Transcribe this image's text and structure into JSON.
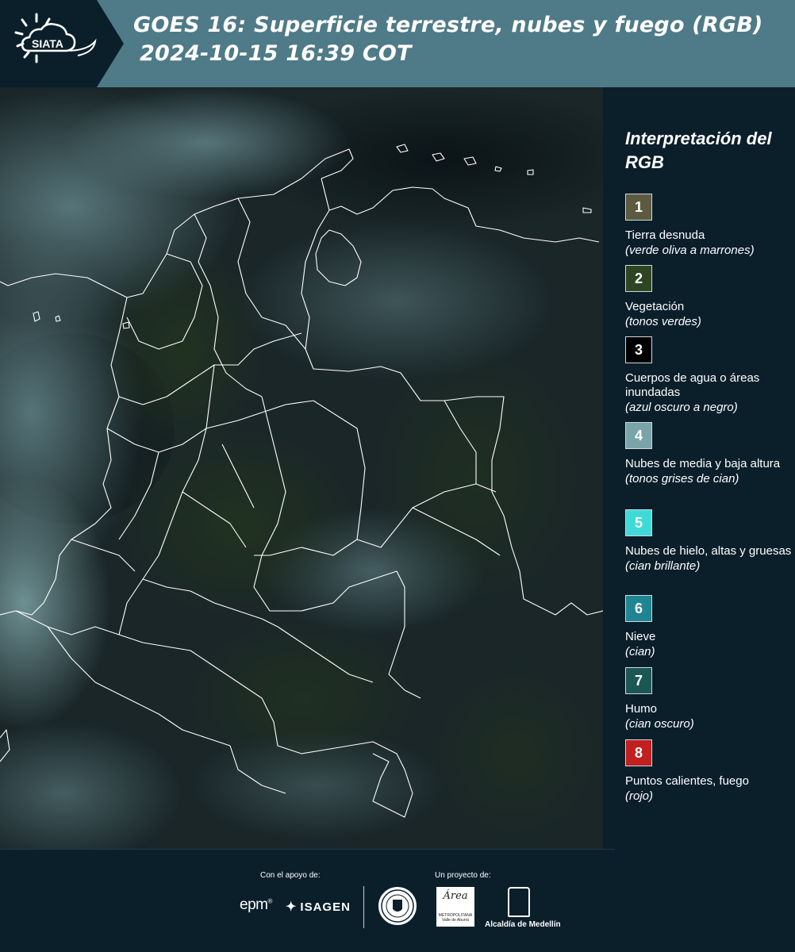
{
  "header": {
    "logo_text": "SIATA",
    "title_line1": "GOES 16: Superficie terrestre, nubes y fuego (RGB)",
    "title_line2": "2024-10-15 16:39 COT",
    "bg_color": "#4f7a87",
    "logo_panel_color": "#0b1f2b"
  },
  "legend": {
    "title": "Interpretación del RGB",
    "items": [
      {
        "num": "1",
        "label": "Tierra desnuda",
        "sub": "(verde oliva a marrones)",
        "color": "#5c5a3f"
      },
      {
        "num": "2",
        "label": "Vegetación",
        "sub": "(tonos verdes)",
        "color": "#2f4521"
      },
      {
        "num": "3",
        "label": "Cuerpos de agua o áreas inundadas",
        "sub": "(azul oscuro a negro)",
        "color": "#000000"
      },
      {
        "num": "4",
        "label": "Nubes de media y baja altura",
        "sub": "(tonos grises de cian)",
        "color": "#79a5aa"
      },
      {
        "num": "5",
        "label": "Nubes de hielo, altas y gruesas",
        "sub": "(cian brillante)",
        "color": "#3fdad8"
      },
      {
        "num": "6",
        "label": "Nieve",
        "sub": "(cian)",
        "color": "#1f8593"
      },
      {
        "num": "7",
        "label": "Humo",
        "sub": "(cian oscuro)",
        "color": "#1d5755"
      },
      {
        "num": "8",
        "label": "Puntos calientes, fuego",
        "sub": "(rojo)",
        "color": "#c0201f"
      }
    ]
  },
  "footer": {
    "support_label": "Con el apoyo de:",
    "project_label": "Un proyecto de:",
    "epm": "epm",
    "isagen": "ISAGEN",
    "area_logo": "Área",
    "area_sub": "METROPOLITANA Valle de Aburrá",
    "alcaldia": "Alcaldía de Medellín"
  },
  "map": {
    "layer": "GOES-16 RGB",
    "borders_color": "#ffffff",
    "background_color": "#10191b"
  }
}
